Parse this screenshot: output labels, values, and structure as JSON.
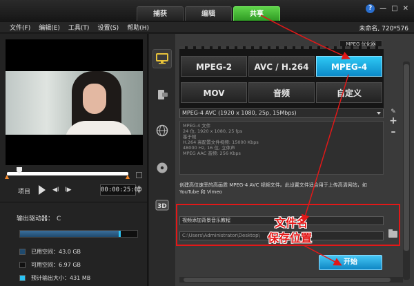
{
  "tabs": [
    {
      "label": "捕获"
    },
    {
      "label": "编辑"
    },
    {
      "label": "共享"
    }
  ],
  "window_controls": {
    "help": "?"
  },
  "menu": {
    "items": [
      "文件(F)",
      "编辑(E)",
      "工具(T)",
      "设置(S)",
      "帮助(H)"
    ],
    "project_info": "未命名, 720*576"
  },
  "player": {
    "mode_label": "项目",
    "timecode": "00:00:25:00"
  },
  "storage": {
    "drive_label": "输出驱动器：",
    "drive_letter": "C",
    "used_fraction": 0.84,
    "output_fraction": 0.02,
    "legend": [
      {
        "label": "已用空间：",
        "value": "43.0 GB",
        "color": "#1f4a6e"
      },
      {
        "label": "可用空间：",
        "value": "6.97 GB",
        "color": "#111111"
      },
      {
        "label": "预计输出大小：",
        "value": "431 MB",
        "color": "#2bc3f3"
      }
    ]
  },
  "share": {
    "optimizer_badge": "MPEG 优化器",
    "formats": [
      {
        "label": "MPEG-2",
        "selected": false
      },
      {
        "label": "AVC / H.264",
        "selected": false
      },
      {
        "label": "MPEG-4",
        "selected": true
      },
      {
        "label": "MOV",
        "selected": false
      },
      {
        "label": "音频",
        "selected": false
      },
      {
        "label": "自定义",
        "selected": false
      }
    ],
    "profile": "MPEG-4 AVC (1920 x 1080, 25p, 15Mbps)",
    "details": [
      "MPEG-4 文件",
      "24 位, 1920 x 1080, 25 fps",
      "基于帧",
      "H.264 高配置文件视频: 15000 Kbps",
      "48000 Hz, 16 位, 立体声",
      "MPEG AAC 音频: 256 Kbps"
    ],
    "description": "创建高位速率的高画质 MPEG-4 AVC 视频文件。此设置文件适合用于上传高清网站，如 YouTube 和 Vimeo",
    "file_name": "视频添加背景音乐教程",
    "save_path": "C:\\Users\\Administrator\\Desktop\\",
    "start_label": "开始"
  },
  "annotations": {
    "filename_label": "文件名",
    "location_label": "保存位置",
    "color": "#e21818"
  }
}
